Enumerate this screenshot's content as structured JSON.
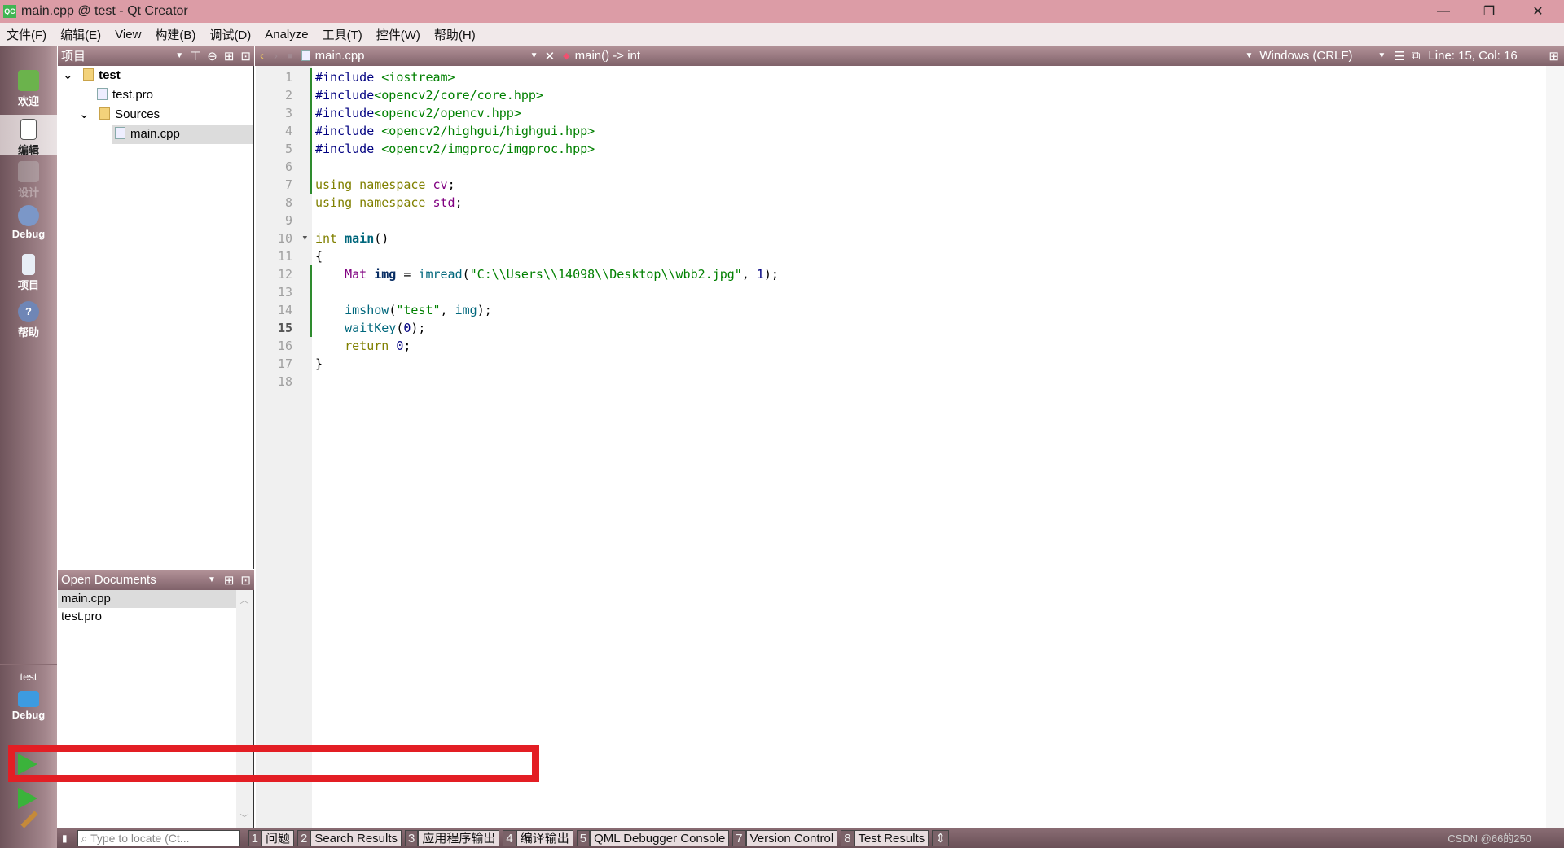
{
  "window": {
    "title": "main.cpp @ test - Qt Creator",
    "app_icon": "QC"
  },
  "menu": [
    "文件(F)",
    "编辑(E)",
    "View",
    "构建(B)",
    "调试(D)",
    "Analyze",
    "工具(T)",
    "控件(W)",
    "帮助(H)"
  ],
  "modes": [
    {
      "label": "欢迎",
      "icon": "qt-welcome-icon"
    },
    {
      "label": "编辑",
      "icon": "edit-icon",
      "selected": true
    },
    {
      "label": "设计",
      "icon": "design-icon",
      "disabled": true
    },
    {
      "label": "Debug",
      "icon": "debug-bug-icon"
    },
    {
      "label": "项目",
      "icon": "project-icon"
    },
    {
      "label": "帮助",
      "icon": "help-icon"
    }
  ],
  "kit": {
    "project": "test",
    "mode": "Debug"
  },
  "project_panel": {
    "title": "项目",
    "tree": [
      {
        "label": "test",
        "bold": true
      },
      {
        "label": "test.pro"
      },
      {
        "label": "Sources"
      },
      {
        "label": "main.cpp",
        "selected": true
      }
    ]
  },
  "open_documents": {
    "title": "Open Documents",
    "items": [
      "main.cpp",
      "test.pro"
    ]
  },
  "editor": {
    "file": "main.cpp",
    "symbol": "main() -> int",
    "line_ending": "Windows (CRLF)",
    "position": "Line: 15, Col: 16",
    "current_line": 15,
    "lines": [
      [
        [
          "#include",
          "pp"
        ],
        [
          " <iostream>",
          "str"
        ]
      ],
      [
        [
          "#include",
          "pp"
        ],
        [
          "<opencv2/core/core.hpp>",
          "str"
        ]
      ],
      [
        [
          "#include",
          "pp"
        ],
        [
          "<opencv2/opencv.hpp>",
          "str"
        ]
      ],
      [
        [
          "#include",
          "pp"
        ],
        [
          " <opencv2/highgui/highgui.hpp>",
          "str"
        ]
      ],
      [
        [
          "#include",
          "pp"
        ],
        [
          " <opencv2/imgproc/imgproc.hpp>",
          "str"
        ]
      ],
      [],
      [
        [
          "using namespace ",
          "kw"
        ],
        [
          "cv",
          "ns"
        ],
        [
          ";",
          "p"
        ]
      ],
      [
        [
          "using namespace ",
          "kw"
        ],
        [
          "std",
          "ns"
        ],
        [
          ";",
          "p"
        ]
      ],
      [],
      [
        [
          "int ",
          "kw"
        ],
        [
          "main",
          "fnb"
        ],
        [
          "()",
          "p"
        ]
      ],
      [
        [
          "{",
          "p"
        ]
      ],
      [
        [
          "    ",
          "p"
        ],
        [
          "Mat",
          "ty"
        ],
        [
          " ",
          "p"
        ],
        [
          "img",
          "vb"
        ],
        [
          " = ",
          "p"
        ],
        [
          "imread",
          "fn"
        ],
        [
          "(",
          "p"
        ],
        [
          "\"C:\\\\Users\\\\14098\\\\Desktop\\\\wbb2.jpg\"",
          "str"
        ],
        [
          ", ",
          "p"
        ],
        [
          "1",
          "num"
        ],
        [
          ");",
          "p"
        ]
      ],
      [],
      [
        [
          "    ",
          "p"
        ],
        [
          "imshow",
          "fn"
        ],
        [
          "(",
          "p"
        ],
        [
          "\"test\"",
          "str"
        ],
        [
          ", ",
          "p"
        ],
        [
          "img",
          "fn"
        ],
        [
          ");",
          "p"
        ]
      ],
      [
        [
          "    ",
          "p"
        ],
        [
          "waitKey",
          "fn"
        ],
        [
          "(",
          "p"
        ],
        [
          "0",
          "num"
        ],
        [
          ");",
          "p"
        ]
      ],
      [
        [
          "    ",
          "p"
        ],
        [
          "return ",
          "kw"
        ],
        [
          "0",
          "num"
        ],
        [
          ";",
          "p"
        ]
      ],
      [
        [
          "}",
          "p"
        ]
      ],
      []
    ]
  },
  "output_panes": [
    {
      "n": "1",
      "label": "问题"
    },
    {
      "n": "2",
      "label": "Search Results"
    },
    {
      "n": "3",
      "label": "应用程序输出"
    },
    {
      "n": "4",
      "label": "编译输出"
    },
    {
      "n": "5",
      "label": "QML Debugger Console"
    },
    {
      "n": "7",
      "label": "Version Control"
    },
    {
      "n": "8",
      "label": "Test Results"
    }
  ],
  "locator": {
    "placeholder": "Type to locate (Ct..."
  },
  "watermark": "CSDN @66的250",
  "colors": {
    "highlight_box": "#e31e24",
    "titlebar": "#dc9ca6",
    "keyword": "#808000",
    "string": "#008000",
    "preprocessor": "#000080",
    "namespace": "#800080",
    "function": "#00677c"
  }
}
